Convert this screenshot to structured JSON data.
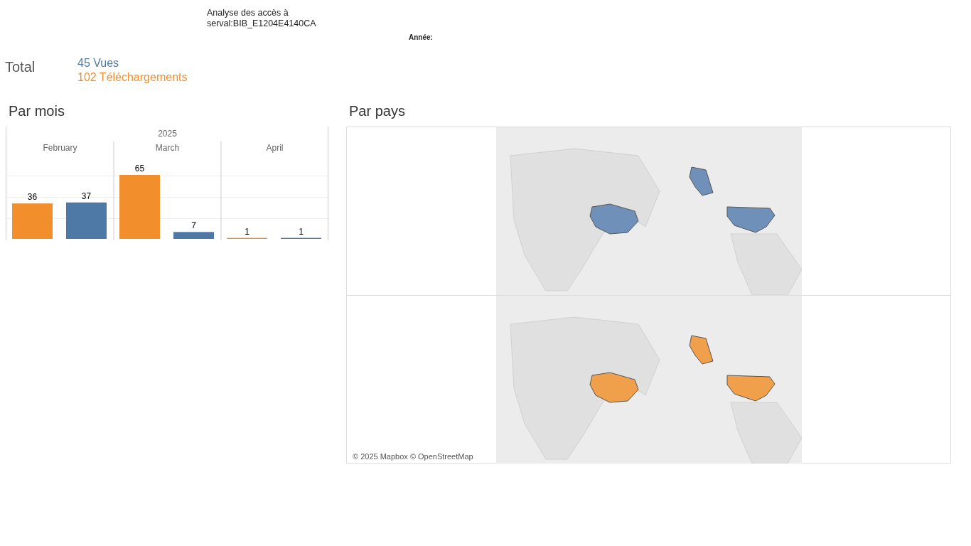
{
  "title_lines": [
    "Analyse des accès à",
    "serval:BIB_E1204E4140CA"
  ],
  "filter": {
    "label": "Année:"
  },
  "totals": {
    "label": "Total",
    "items": [
      {
        "text": "45 Vues",
        "color": "#4e79a7"
      },
      {
        "text": "102 Téléchargements",
        "color": "#f28e2b"
      }
    ]
  },
  "by_month": {
    "heading": "Par mois",
    "chart_data": {
      "type": "bar",
      "title": "2025",
      "categories": [
        "February",
        "March",
        "April"
      ],
      "series": [
        {
          "color": "#f28e2b",
          "values": [
            36,
            65,
            1
          ]
        },
        {
          "color": "#4e79a7",
          "values": [
            37,
            7,
            1
          ]
        }
      ],
      "data_labels": true
    }
  },
  "by_country": {
    "heading": "Par pays",
    "maps": [
      {
        "color": "#6f90b8"
      },
      {
        "color": "#f0a04b"
      }
    ],
    "attribution": "© 2025 Mapbox © OpenStreetMap"
  }
}
